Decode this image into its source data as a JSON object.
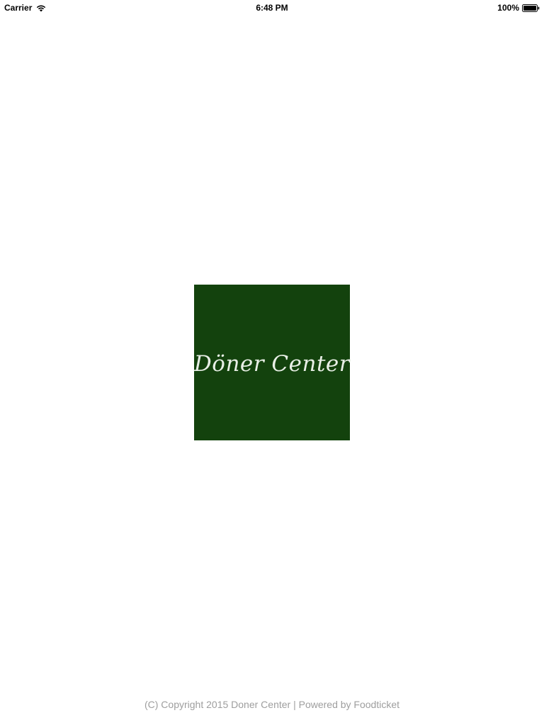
{
  "status_bar": {
    "carrier": "Carrier",
    "time": "6:48 PM",
    "battery_percent": "100%",
    "battery_level": 1.0,
    "wifi_icon": "wifi-icon",
    "battery_icon": "battery-icon"
  },
  "logo": {
    "text": "Döner Center",
    "background_color": "#13420d",
    "text_color": "#e8efe6"
  },
  "footer": {
    "text": "(C) Copyright 2015 Doner Center | Powered by Foodticket",
    "color": "#9e9e9e"
  }
}
